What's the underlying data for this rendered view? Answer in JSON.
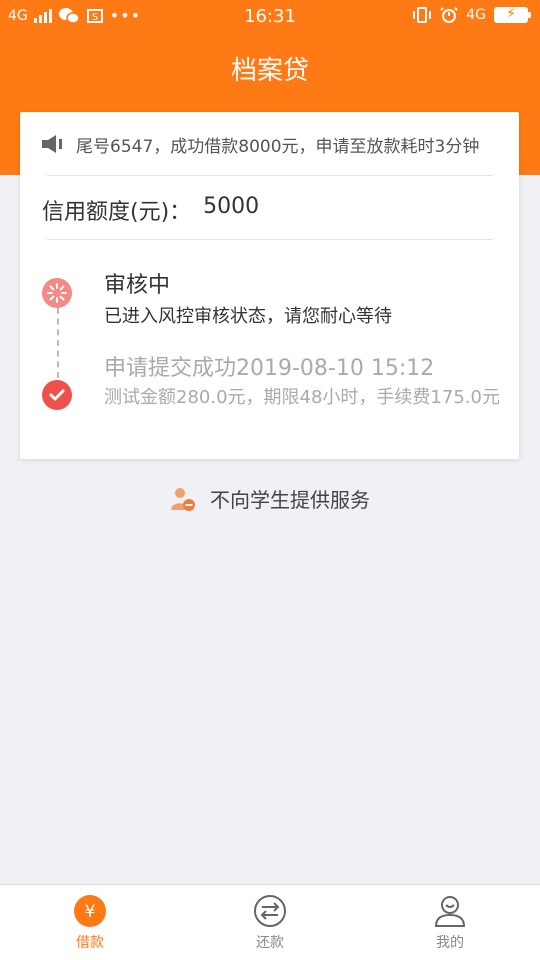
{
  "status_bar": {
    "network": "4G",
    "time": "16:31",
    "right_network": "4G"
  },
  "header": {
    "title": "档案贷"
  },
  "card": {
    "notice_text": "尾号6547，成功借款8000元，申请至放款耗时3分钟",
    "credit_label": "信用额度(元)：",
    "credit_value": "5000",
    "steps": [
      {
        "title": "审核中",
        "desc": "已进入风控审核状态，请您耐心等待",
        "status": "pending"
      },
      {
        "title": "申请提交成功2019-08-10 15:12",
        "desc": "测试金额280.0元，期限48小时，手续费175.0元",
        "status": "done"
      }
    ]
  },
  "notice_no_students": "不向学生提供服务",
  "bottom_nav": {
    "items": [
      {
        "label": "借款",
        "icon": "yen-icon",
        "active": true
      },
      {
        "label": "还款",
        "icon": "exchange-icon",
        "active": false
      },
      {
        "label": "我的",
        "icon": "user-icon",
        "active": false
      }
    ]
  },
  "colors": {
    "accent": "#ff7a14",
    "pending_dot": "#f38a84",
    "done_dot": "#f0504c",
    "background": "#eff1f4"
  }
}
